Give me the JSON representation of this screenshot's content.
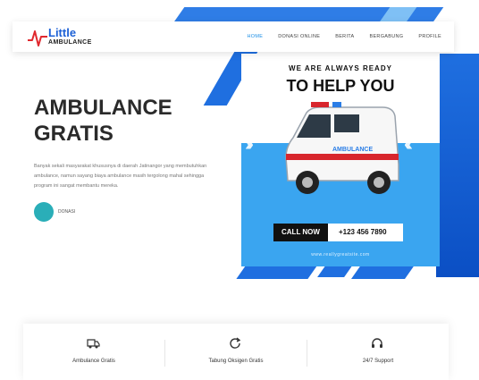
{
  "header": {
    "logo_line1": "Little",
    "logo_line2": "AMBULANCE",
    "nav": [
      "HOME",
      "DONASI ONLINE",
      "BERITA",
      "BERGABUNG",
      "PROFILE"
    ]
  },
  "hero": {
    "title_line1": "AMBULANCE",
    "title_line2": "GRATIS",
    "description": "Banyak sekali masyarakat khususnya di daerah Jatinangor yang membutuhkan ambulance, namun sayang biaya ambulance masih tergolong mahal sehingga program ini sangat membantu mereka.",
    "button_label": "DONASI"
  },
  "promo": {
    "subtitle": "WE ARE ALWAYS READY",
    "headline": "TO HELP YOU",
    "vehicle_text": "AMBULANCE",
    "call_label": "CALL NOW",
    "phone": "+123 456 7890",
    "url": "www.reallygreatsite.com"
  },
  "features": [
    {
      "icon": "ambulance-icon",
      "label": "Ambulance Gratis"
    },
    {
      "icon": "oxygen-refresh-icon",
      "label": "Tabung Oksigen Gratis"
    },
    {
      "icon": "headset-support-icon",
      "label": "24/7 Support"
    }
  ],
  "colors": {
    "brand_blue": "#1f6fe0",
    "light_blue": "#3aa5f0",
    "teal_button": "#2aaeb8",
    "logo_red": "#e0282e"
  }
}
